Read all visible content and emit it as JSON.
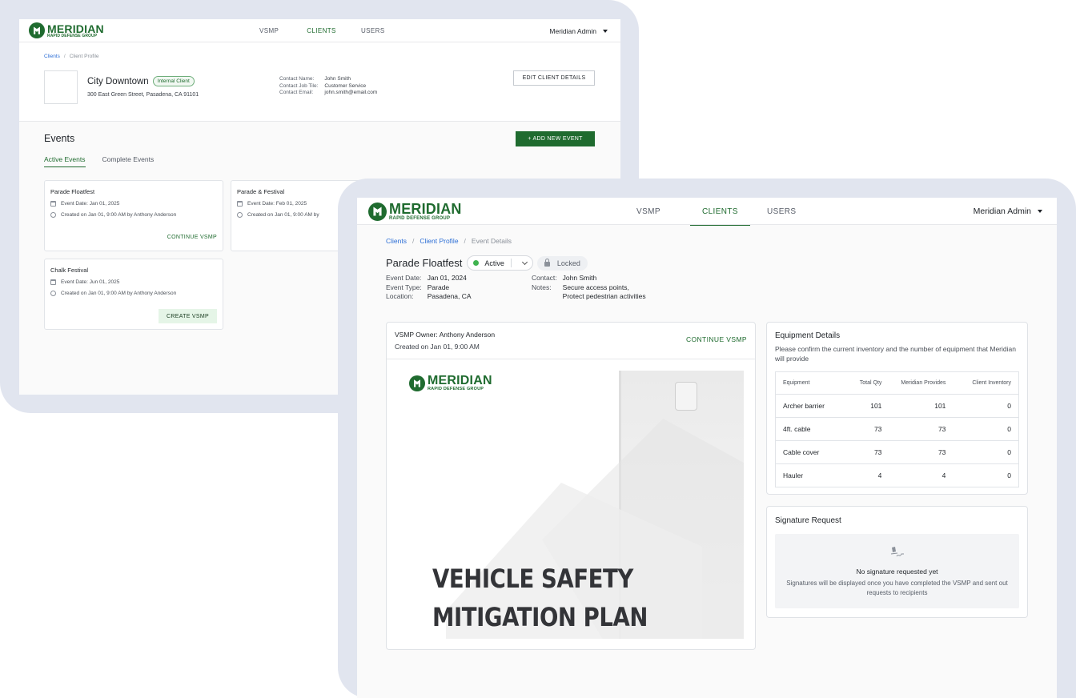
{
  "brand": {
    "name": "MERIDIAN",
    "tagline": "RAPID DEFENSE GROUP",
    "accent_color": "#1f6b2f",
    "link_color": "#2d6fd6",
    "frame_color": "#e1e5ef"
  },
  "nav": {
    "items": [
      "VSMP",
      "CLIENTS",
      "USERS"
    ],
    "active": "CLIENTS",
    "user_menu": "Meridian Admin"
  },
  "client_profile": {
    "breadcrumb": {
      "root": "Clients",
      "current": "Client Profile"
    },
    "client_name": "City Downtown",
    "badge": "Internal Client",
    "address": "300 East Green Street, Pasadena, CA 91101",
    "contact": {
      "labels": [
        "Contact Name:",
        "Contact Job Tile:",
        "Contact Email:"
      ],
      "values": [
        "John Smith",
        "Customer Service",
        "john.smith@email.com"
      ]
    },
    "edit_button": "EDIT CLIENT DETAILS",
    "events_heading": "Events",
    "add_event_button": "+ ADD NEW EVENT",
    "tabs": [
      "Active Events",
      "Complete Events"
    ],
    "active_tab": "Active Events",
    "events": [
      {
        "name": "Parade Floatfest",
        "date": "Event Date: Jan 01, 2025",
        "created": "Created on Jan 01, 9:00 AM by Anthony Anderson",
        "action": "CONTINUE VSMP"
      },
      {
        "name": "Parade & Festival",
        "date": "Event Date: Feb 01, 2025",
        "created": "Created on Jan 01, 9:00 AM by",
        "action": ""
      },
      {
        "name": "Chalk Festival",
        "date": "Event Date: Jun 01, 2025",
        "created": "Created on Jan 01, 9:00 AM by Anthony Anderson",
        "action": "CREATE VSMP"
      }
    ]
  },
  "event_details": {
    "breadcrumb": {
      "root": "Clients",
      "middle": "Client Profile",
      "current": "Event Details"
    },
    "title": "Parade Floatfest",
    "status": "Active",
    "status_color": "#3fb34f",
    "lock_label": "Locked",
    "info_left": {
      "labels": [
        "Event Date:",
        "Event Type:",
        "Location:"
      ],
      "values": [
        "Jan 01, 2024",
        "Parade",
        "Pasadena, CA"
      ]
    },
    "info_right": {
      "labels": [
        "Contact:",
        "Notes:",
        ""
      ],
      "values": [
        "John Smith",
        "Secure access points,",
        "Protect pedestrian activities"
      ]
    },
    "vsmp": {
      "owner_label": "VSMP Owner:",
      "owner": "Anthony Anderson",
      "created": "Created on Jan 01, 9:00 AM",
      "action": "CONTINUE VSMP",
      "cover_line1": "VEHICLE SAFETY",
      "cover_line2": "MITIGATION PLAN"
    },
    "equipment": {
      "title": "Equipment Details",
      "subtitle": "Please confirm the current inventory and the number of equipment that Meridian will provide",
      "columns": [
        "Equipment",
        "Total Qty",
        "Meridian Provides",
        "Client Inventory"
      ],
      "rows": [
        [
          "Archer barrier",
          "101",
          "101",
          "0"
        ],
        [
          "4ft. cable",
          "73",
          "73",
          "0"
        ],
        [
          "Cable cover",
          "73",
          "73",
          "0"
        ],
        [
          "Hauler",
          "4",
          "4",
          "0"
        ]
      ]
    },
    "signature": {
      "title": "Signature Request",
      "empty_title": "No signature requested yet",
      "empty_body": "Signatures will be displayed once you have completed the VSMP and sent out requests to recipients",
      "icon": "signature-icon"
    }
  }
}
